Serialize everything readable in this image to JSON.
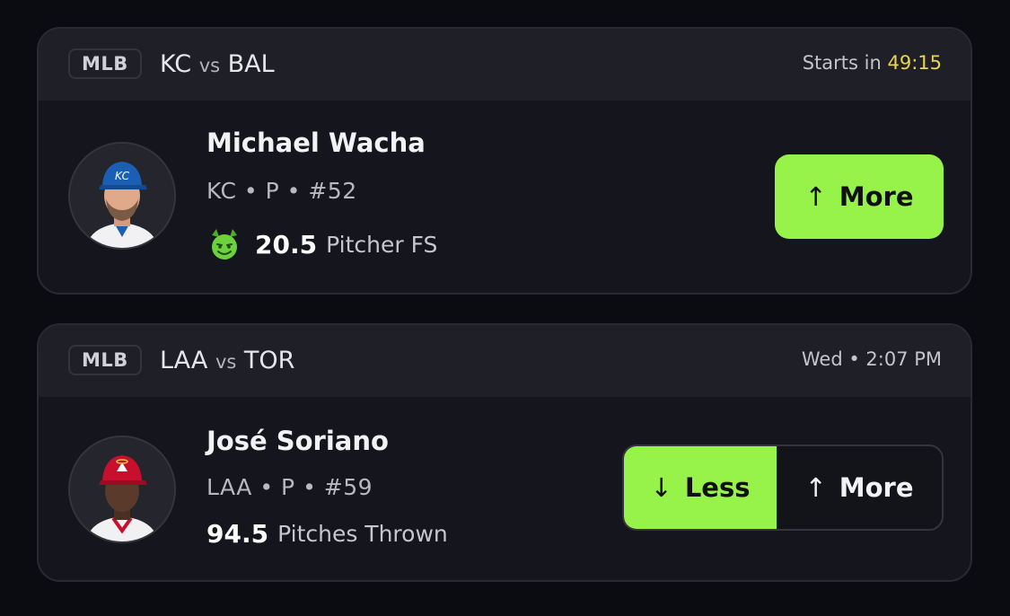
{
  "cards": [
    {
      "league": "MLB",
      "home_team": "KC",
      "vs": "vs",
      "away_team": "BAL",
      "time_prefix": "Starts in",
      "time_value": "49:15",
      "player_name": "Michael Wacha",
      "player_meta": "KC • P • #52",
      "stat_icon": "demon-icon",
      "stat_value": "20.5",
      "stat_label": "Pitcher FS",
      "more_label": "More",
      "selected": "more"
    },
    {
      "league": "MLB",
      "home_team": "LAA",
      "vs": "vs",
      "away_team": "TOR",
      "time_text": "Wed • 2:07 PM",
      "player_name": "José Soriano",
      "player_meta": "LAA • P • #59",
      "stat_value": "94.5",
      "stat_label": "Pitches Thrown",
      "less_label": "Less",
      "more_label": "More",
      "selected": "less"
    }
  ],
  "colors": {
    "accent_green": "#97f34a",
    "countdown_yellow": "#ecd44c",
    "kc_blue": "#1b5fb4",
    "laa_red": "#c8102e"
  }
}
